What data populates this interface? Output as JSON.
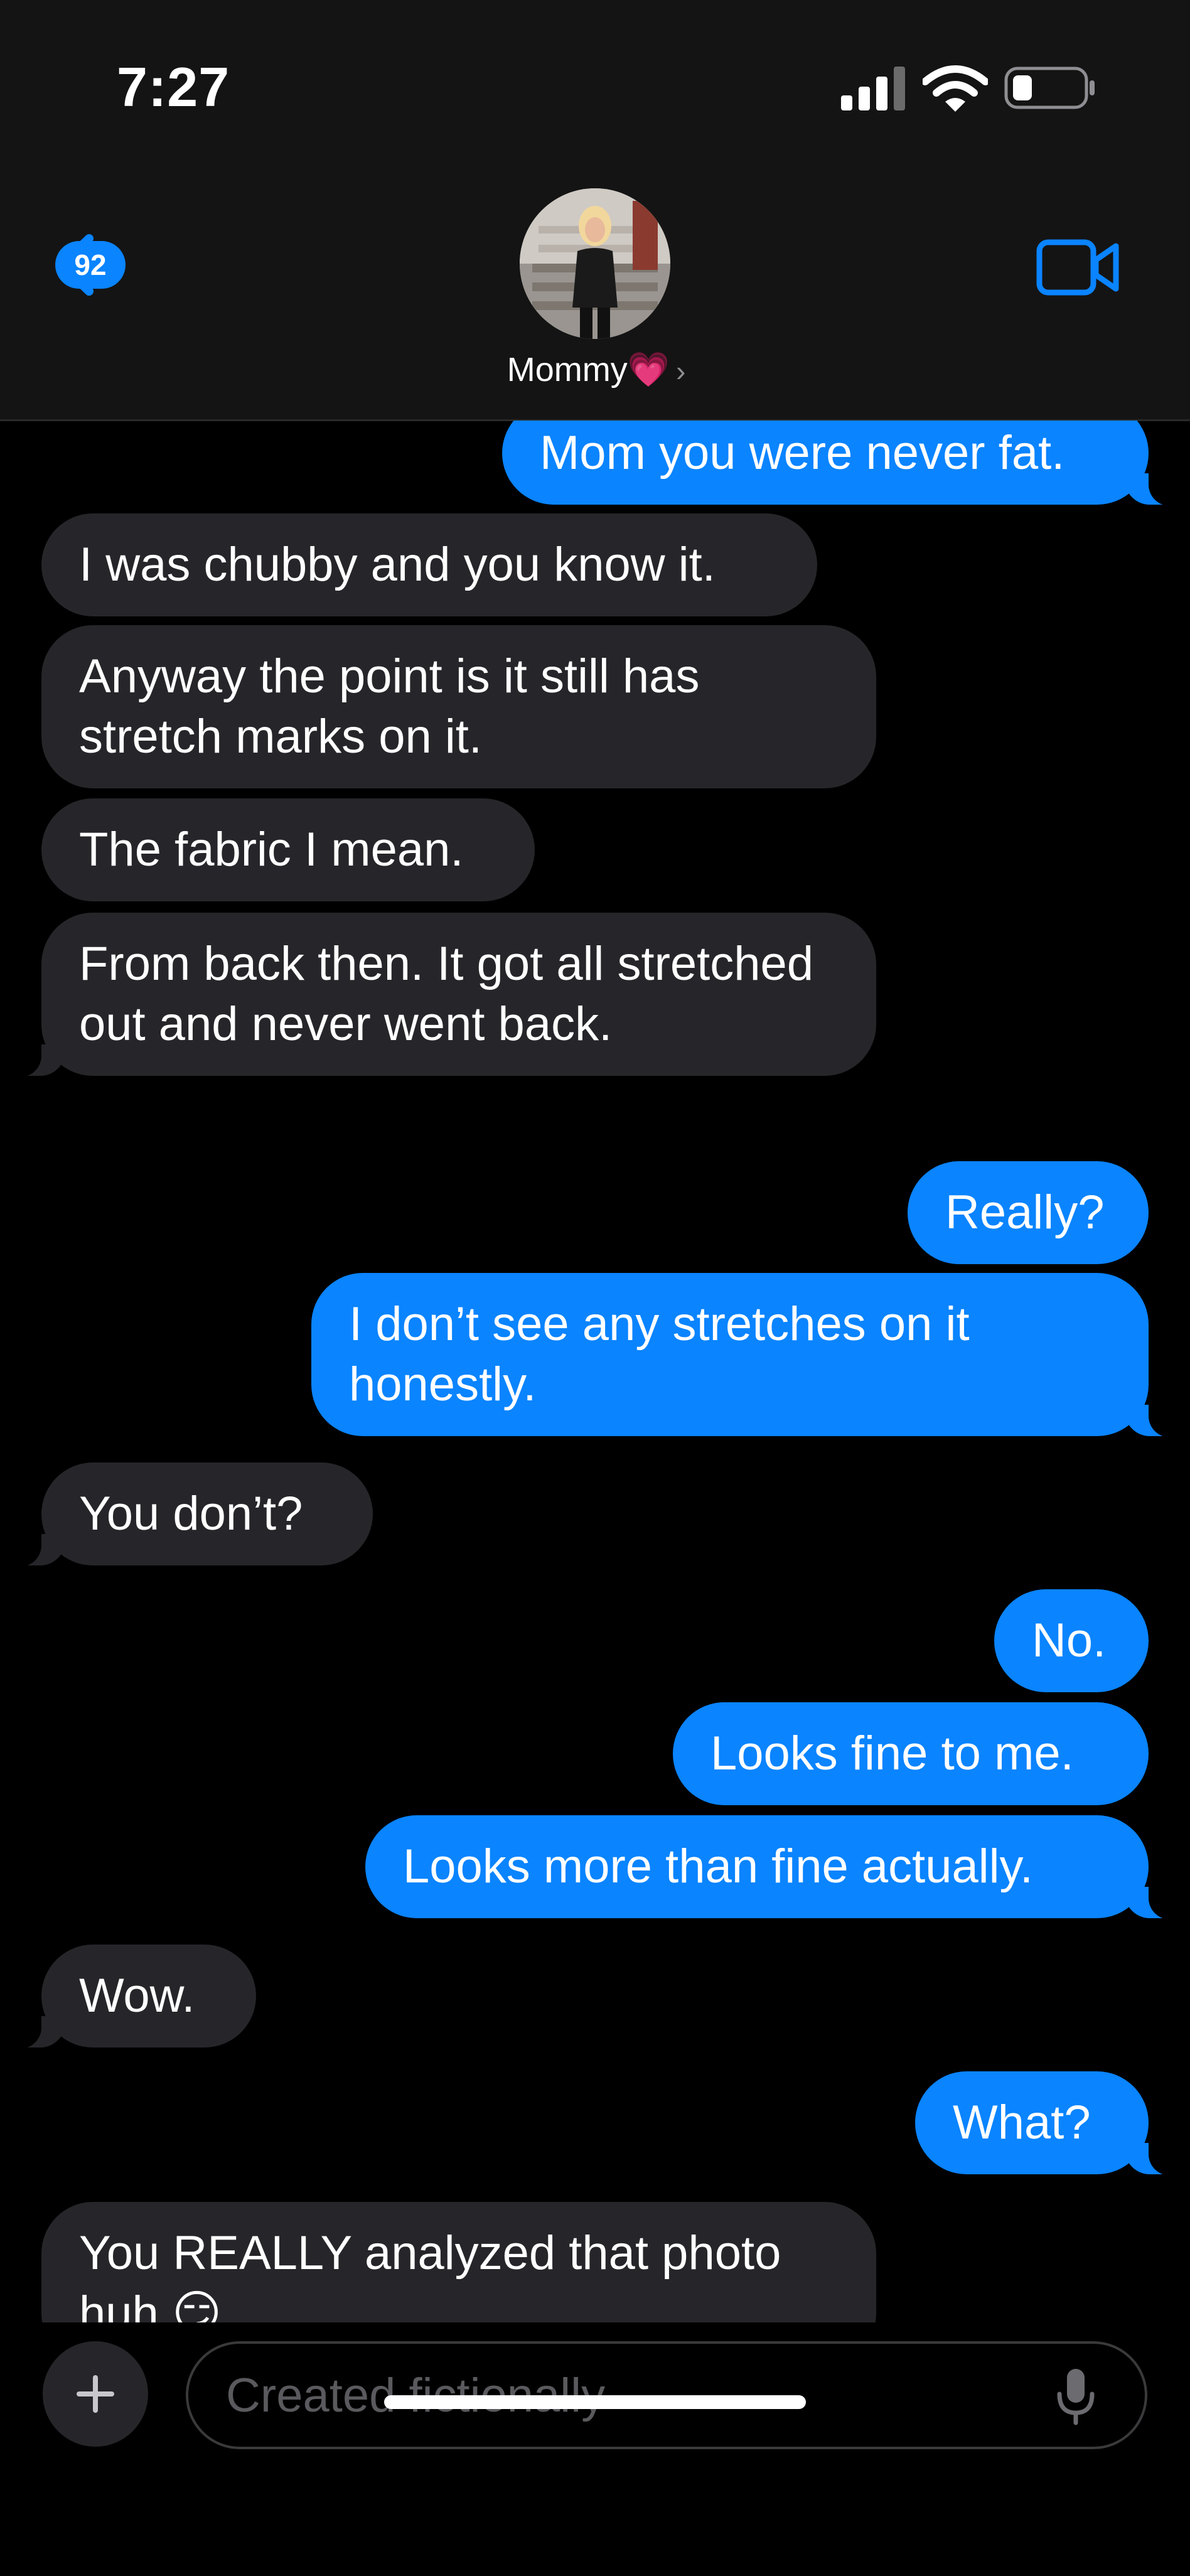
{
  "status_bar": {
    "time": "7:27",
    "icons": [
      "cellular-signal-icon",
      "wifi-icon",
      "battery-icon"
    ]
  },
  "header": {
    "back_count": "92",
    "contact_name": "Mommy",
    "contact_emoji": "💗",
    "icons": [
      "back-chevron-icon",
      "video-call-icon",
      "chevron-right-icon"
    ]
  },
  "messages": [
    {
      "side": "out",
      "text": "Mom you were never fat."
    },
    {
      "side": "in",
      "text": "I was chubby and you know it."
    },
    {
      "side": "in",
      "text": "Anyway the point is it still has stretch marks on it."
    },
    {
      "side": "in",
      "text": "The fabric I mean."
    },
    {
      "side": "in",
      "text": "From back then. It got all stretched out and never went back."
    },
    {
      "side": "out",
      "text": "Really?"
    },
    {
      "side": "out",
      "text": "I don’t see any stretches on it honestly."
    },
    {
      "side": "in",
      "text": "You don’t?"
    },
    {
      "side": "out",
      "text": "No."
    },
    {
      "side": "out",
      "text": "Looks fine to me."
    },
    {
      "side": "out",
      "text": "Looks more than fine actually."
    },
    {
      "side": "in",
      "text": "Wow."
    },
    {
      "side": "out",
      "text": "What?"
    },
    {
      "side": "in",
      "text": "You REALLY analyzed that photo huh 😏"
    }
  ],
  "composer": {
    "placeholder": "Created fictionally",
    "icons": [
      "plus-icon",
      "microphone-icon"
    ]
  },
  "colors": {
    "accent": "#0a84ff",
    "incoming_bubble": "#26262a",
    "background": "#000000",
    "header_bg": "#141414"
  }
}
